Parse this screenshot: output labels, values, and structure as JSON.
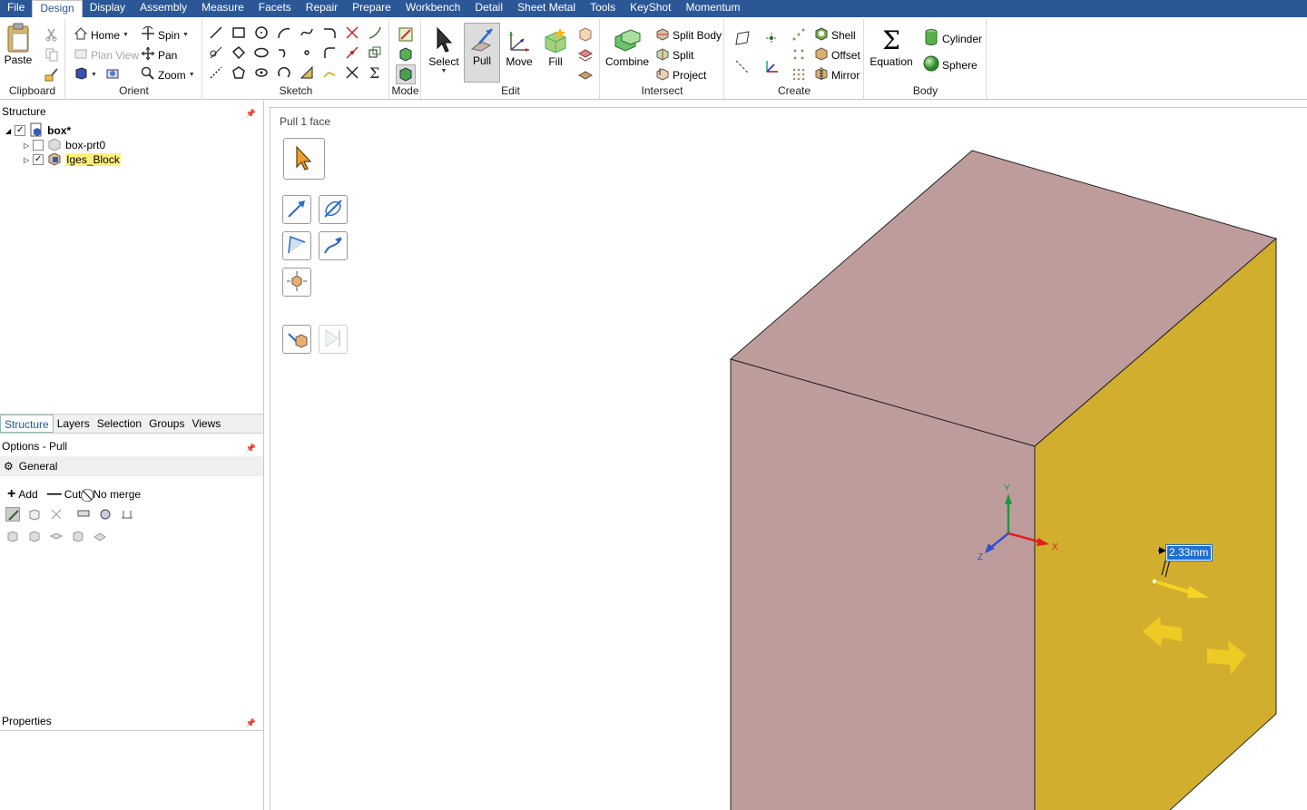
{
  "menu": {
    "items": [
      "File",
      "Design",
      "Display",
      "Assembly",
      "Measure",
      "Facets",
      "Repair",
      "Prepare",
      "Workbench",
      "Detail",
      "Sheet Metal",
      "Tools",
      "KeyShot",
      "Momentum"
    ],
    "active": "Design"
  },
  "ribbon": {
    "clipboard": {
      "label": "Clipboard",
      "paste": "Paste"
    },
    "orient": {
      "label": "Orient",
      "home": "Home",
      "spin": "Spin",
      "plan_view": "Plan View",
      "pan": "Pan",
      "zoom": "Zoom"
    },
    "sketch": {
      "label": "Sketch"
    },
    "mode": {
      "label": "Mode"
    },
    "edit": {
      "label": "Edit",
      "select": "Select",
      "pull": "Pull",
      "move": "Move",
      "fill": "Fill"
    },
    "intersect": {
      "label": "Intersect",
      "combine": "Combine",
      "split_body": "Split Body",
      "split": "Split",
      "project": "Project"
    },
    "create": {
      "label": "Create",
      "shell": "Shell",
      "offset": "Offset",
      "mirror": "Mirror"
    },
    "body": {
      "label": "Body",
      "equation": "Equation",
      "cylinder": "Cylinder",
      "sphere": "Sphere"
    }
  },
  "structure": {
    "title": "Structure",
    "root": "box*",
    "items": [
      {
        "label": "box-prt0",
        "checked": false
      },
      {
        "label": "Iges_Block",
        "checked": true
      }
    ]
  },
  "tabs": [
    "Structure",
    "Layers",
    "Selection",
    "Groups",
    "Views"
  ],
  "active_tab": "Structure",
  "options": {
    "title": "Options - Pull",
    "section": "General",
    "add": "Add",
    "cut": "Cut",
    "no_merge": "No merge"
  },
  "properties": {
    "title": "Properties"
  },
  "viewport": {
    "hint": "Pull 1 face",
    "dimension": "2.33mm",
    "axes": {
      "x": "X",
      "y": "Y",
      "z": "Z"
    },
    "colors": {
      "top_face": "#bf9c9c",
      "front_face": "#bf9c9c",
      "side_face": "#d2ae2e",
      "x_axis": "#e02020",
      "y_axis": "#1a9a3a",
      "z_axis": "#3050d0",
      "arrow": "#f5d422"
    }
  }
}
